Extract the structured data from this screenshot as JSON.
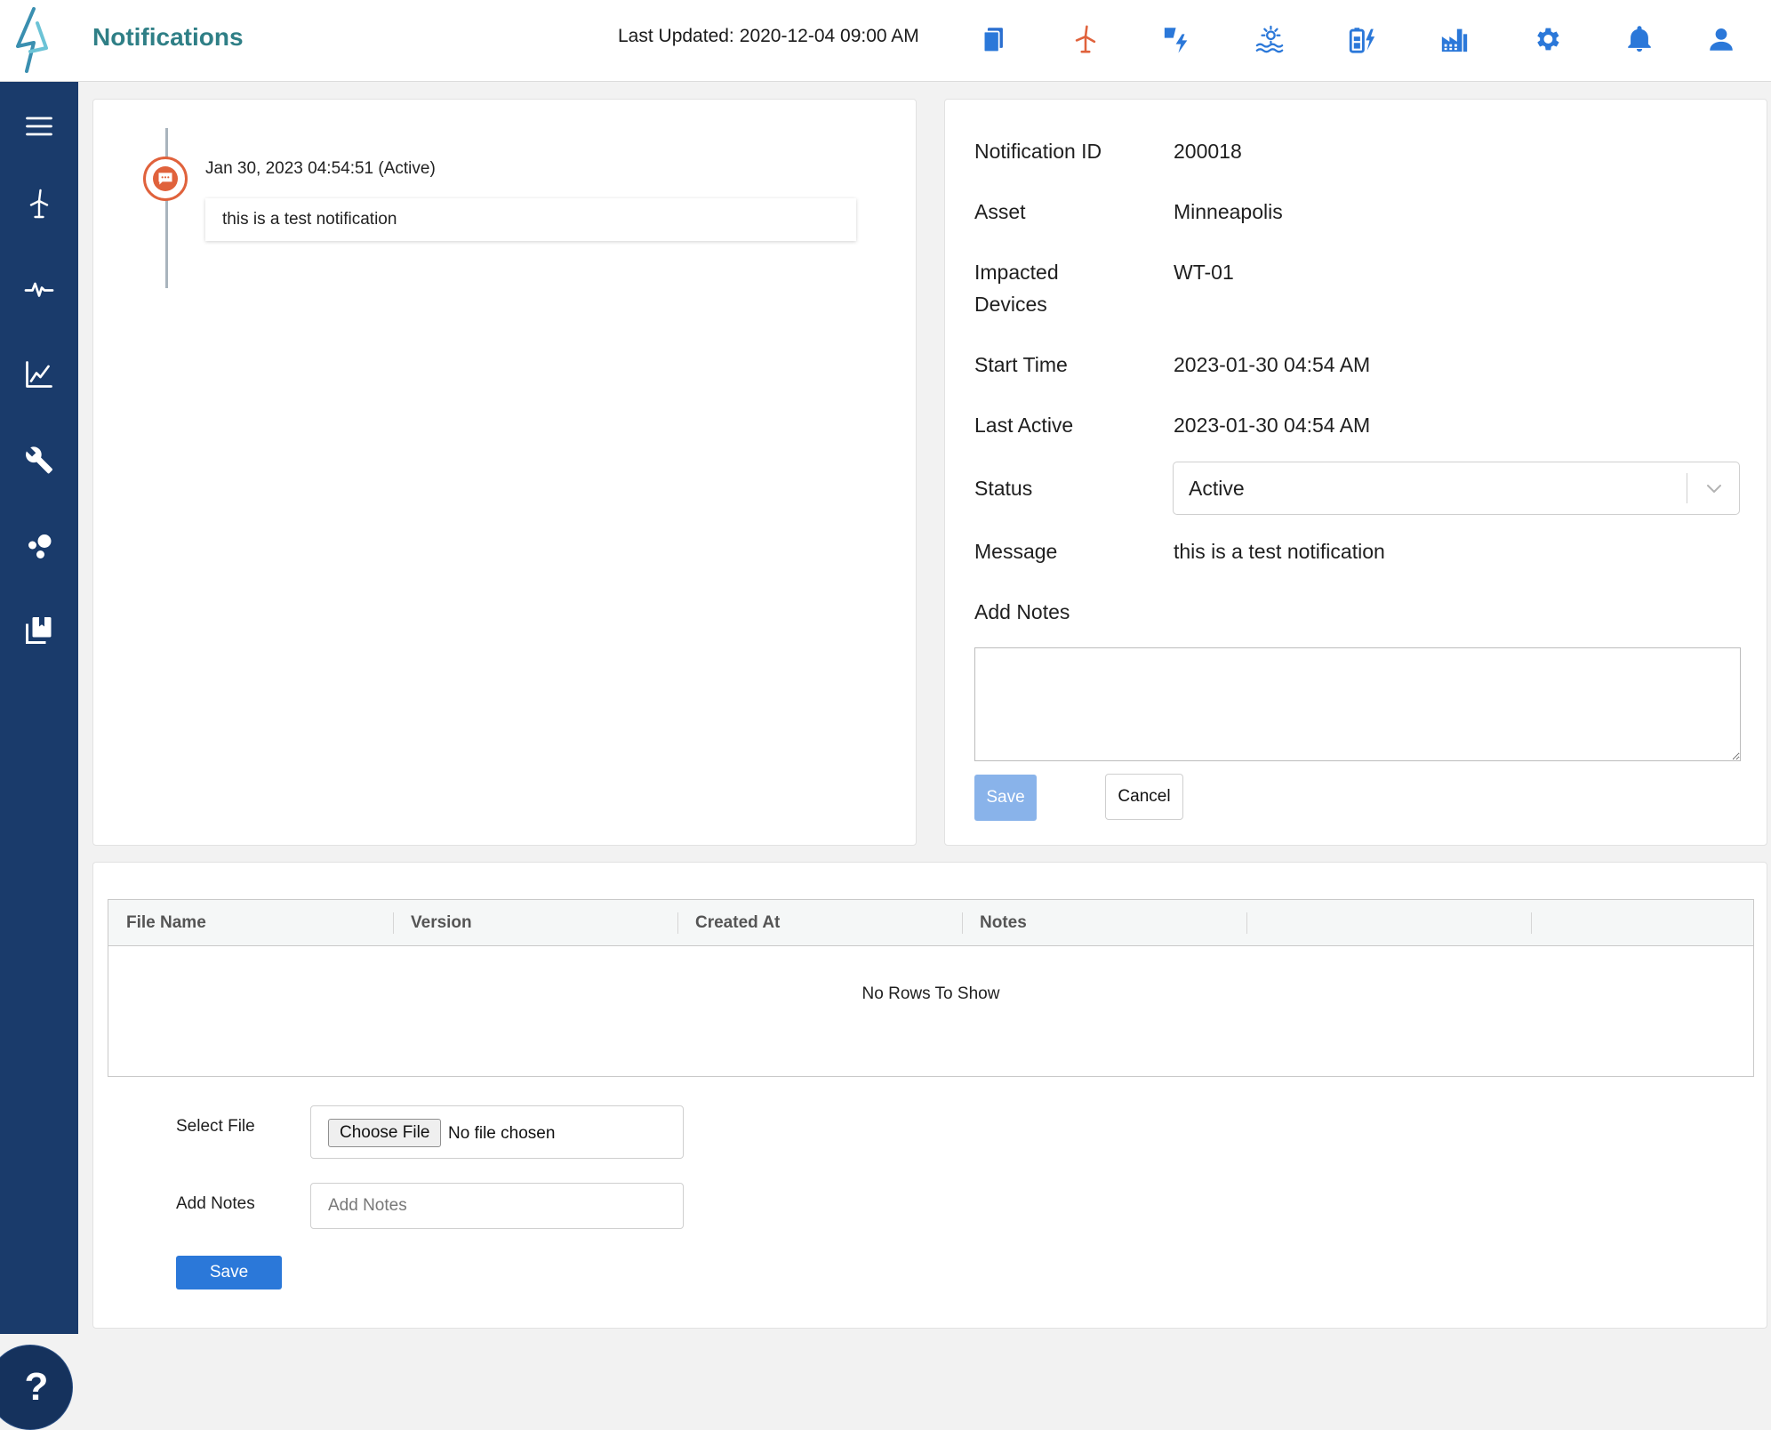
{
  "header": {
    "title": "Notifications",
    "last_updated_label": "Last Updated:",
    "last_updated_value": "2020-12-04 09:00 AM",
    "icons": [
      "book-icon",
      "wind-turbine-icon",
      "solar-bolt-icon",
      "water-sun-icon",
      "battery-bolt-icon",
      "factory-icon",
      "gear-icon",
      "bell-icon",
      "user-icon"
    ]
  },
  "sidebar": {
    "icons": [
      "menu-icon",
      "wind-turbine-icon",
      "pulse-icon",
      "line-chart-icon",
      "wrench-icon",
      "cluster-icon",
      "library-icon"
    ],
    "help_label": "?"
  },
  "timeline": {
    "items": [
      {
        "date": "Jan 30, 2023 04:54:51 (Active)",
        "message": "this is a test notification"
      }
    ]
  },
  "details": {
    "rows": [
      {
        "label": "Notification ID",
        "value": "200018"
      },
      {
        "label": "Asset",
        "value": "Minneapolis"
      },
      {
        "label": "Impacted Devices",
        "value": "WT-01"
      },
      {
        "label": "Start Time",
        "value": "2023-01-30 04:54 AM"
      },
      {
        "label": "Last Active",
        "value": "2023-01-30 04:54 AM"
      }
    ],
    "status_label": "Status",
    "status_value": "Active",
    "message_label": "Message",
    "message_value": "this is a test notification",
    "notes_label": "Add Notes",
    "save_label": "Save",
    "cancel_label": "Cancel"
  },
  "files": {
    "columns": [
      "File Name",
      "Version",
      "Created At",
      "Notes",
      "",
      ""
    ],
    "empty_text": "No Rows To Show",
    "select_file_label": "Select File",
    "choose_file_label": "Choose File",
    "no_file_text": "No file chosen",
    "add_notes_label": "Add Notes",
    "add_notes_placeholder": "Add Notes",
    "save_label": "Save"
  },
  "colors": {
    "brand": "#2f7f86",
    "sidebar": "#1a3b6b",
    "icon_blue": "#2b78d9",
    "alert_orange": "#e0623c"
  }
}
